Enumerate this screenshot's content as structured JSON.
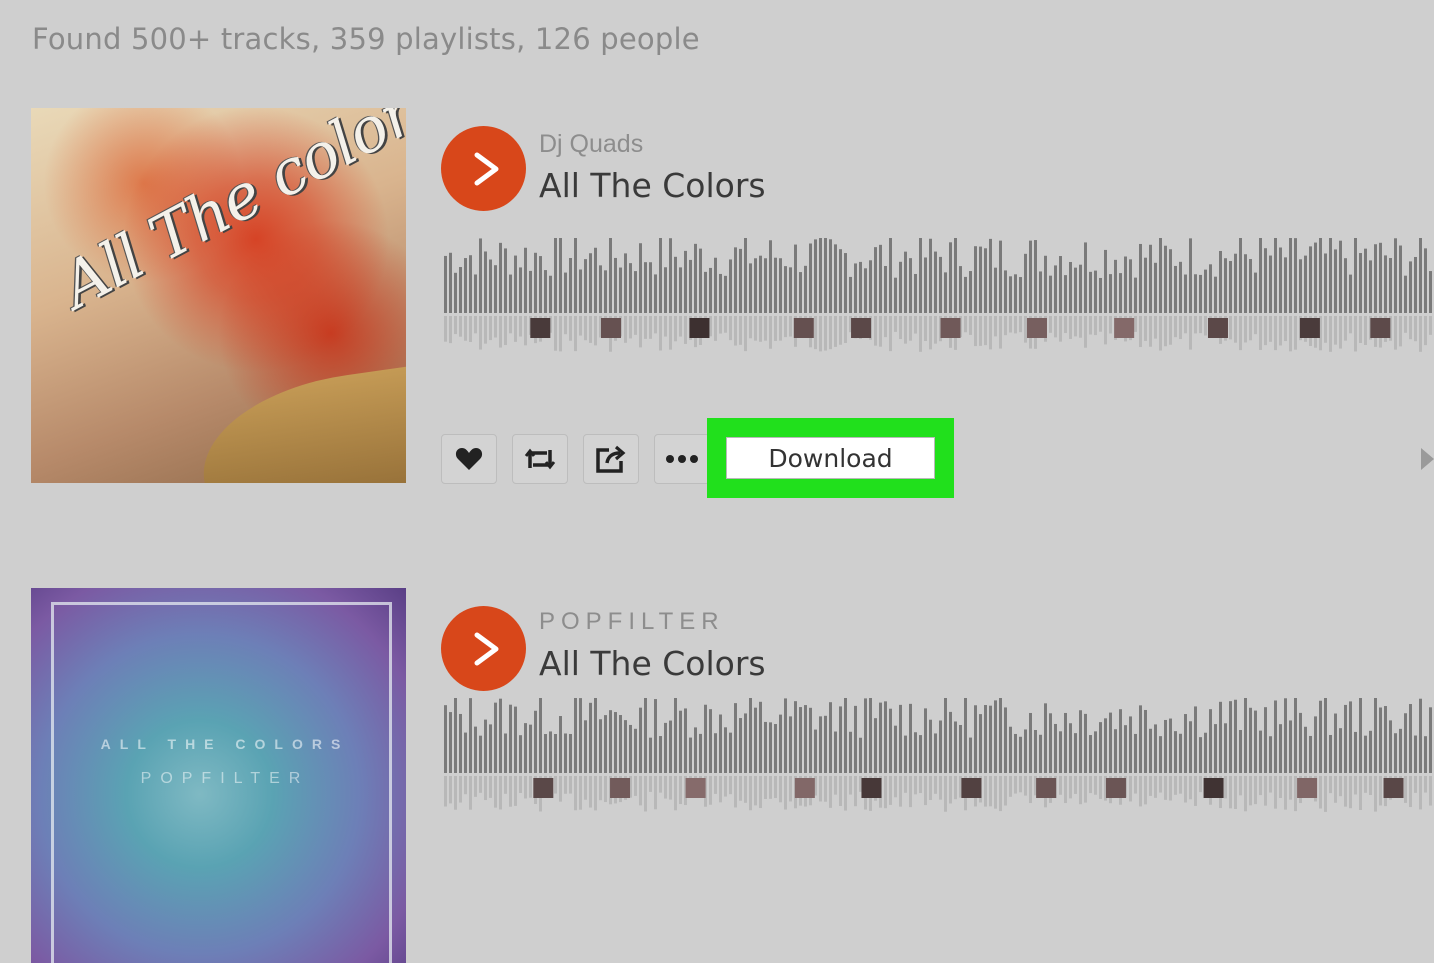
{
  "search": {
    "summary": "Found 500+ tracks, 359 playlists, 126 people"
  },
  "tracks": [
    {
      "artist": "Dj Quads",
      "title": "All The Colors",
      "artwork_text": "All The colors",
      "actions": {
        "like_icon": "heart-icon",
        "repost_icon": "repost-icon",
        "share_icon": "share-icon",
        "more_icon": "more-icon",
        "download_label": "Download"
      }
    },
    {
      "artist": "POPFILTER",
      "title": "All The Colors",
      "artwork_text": "ALL THE COLORS",
      "artwork_subtext": "POPFILTER"
    }
  ],
  "colors": {
    "accent": "#d8471a",
    "highlight": "#21e01c",
    "background": "#cfcfcf"
  }
}
